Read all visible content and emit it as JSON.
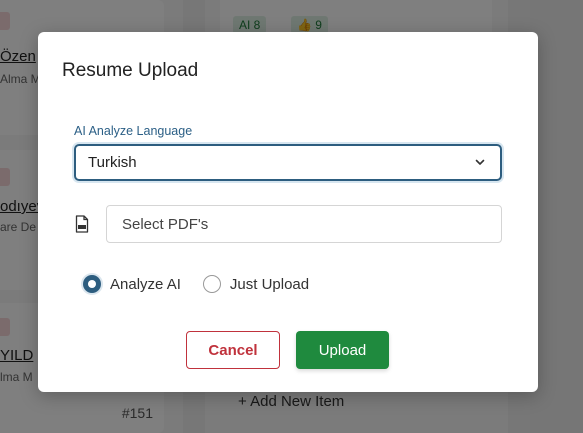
{
  "background": {
    "cards": [
      {
        "name": "Özen",
        "sub": "Alma M"
      },
      {
        "name": "odıyev",
        "sub": "are De"
      },
      {
        "name": "YILD",
        "sub": "lma M"
      }
    ],
    "card_number": "#151",
    "chips": {
      "ai": "AI 8",
      "like": "9"
    },
    "add_item": "+ Add New Item"
  },
  "modal": {
    "title": "Resume Upload",
    "language_label": "AI Analyze Language",
    "language_value": "Turkish",
    "file_placeholder": "Select PDF's",
    "radio_options": [
      {
        "label": "Analyze AI",
        "checked": true
      },
      {
        "label": "Just Upload",
        "checked": false
      }
    ],
    "cancel_label": "Cancel",
    "upload_label": "Upload"
  },
  "colors": {
    "accent": "#2d5d7f",
    "danger": "#c0323c",
    "success": "#1f8a3e"
  }
}
